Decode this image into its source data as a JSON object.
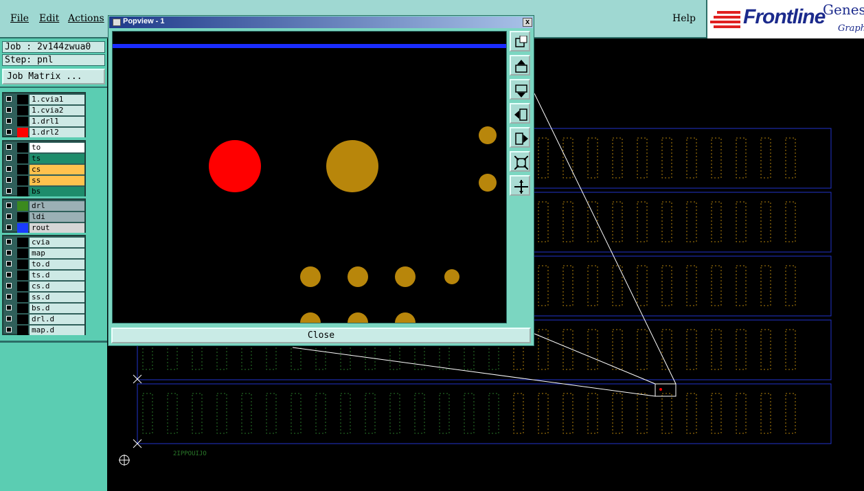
{
  "menu": {
    "file": "File",
    "edit": "Edit",
    "actions": "Actions",
    "help": "Help"
  },
  "logo": {
    "brand": "Frontline",
    "product": "Genes",
    "sub": "Graph"
  },
  "job": {
    "job_line": "Job : 2v144zwua0",
    "step_line": "Step: pnl",
    "matrix_button": "Job Matrix ..."
  },
  "layers": {
    "group1": [
      {
        "name": "1.cvia1",
        "swatch": "#000000",
        "bg": "#cde9e5"
      },
      {
        "name": "1.cvia2",
        "swatch": "#000000",
        "bg": "#cde9e5"
      },
      {
        "name": "1.drl1",
        "swatch": "#000000",
        "bg": "#cde9e5"
      },
      {
        "name": "1.drl2",
        "swatch": "#ff0000",
        "bg": "#cde9e5"
      }
    ],
    "group2": [
      {
        "name": "to",
        "swatch": "#000000",
        "bg": "#ffffff"
      },
      {
        "name": "ts",
        "swatch": "#000000",
        "bg": "#1e8c6b"
      },
      {
        "name": "cs",
        "swatch": "#000000",
        "bg": "#ffc24e"
      },
      {
        "name": "ss",
        "swatch": "#000000",
        "bg": "#ffc24e"
      },
      {
        "name": "bs",
        "swatch": "#000000",
        "bg": "#1e8c6b"
      }
    ],
    "group3": [
      {
        "name": "drl",
        "swatch": "#3b8a1e",
        "bg": "#9bb0b5"
      },
      {
        "name": "ldi",
        "swatch": "#000000",
        "bg": "#9bb0b5"
      },
      {
        "name": "rout",
        "swatch": "#1a3cff",
        "bg": "#d6d6d6"
      }
    ],
    "group4": [
      {
        "name": "cvia",
        "swatch": "#000000",
        "bg": "#cde9e5"
      },
      {
        "name": "map",
        "swatch": "#000000",
        "bg": "#cde9e5"
      },
      {
        "name": "to.d",
        "swatch": "#000000",
        "bg": "#cde9e5"
      },
      {
        "name": "ts.d",
        "swatch": "#000000",
        "bg": "#cde9e5"
      },
      {
        "name": "cs.d",
        "swatch": "#000000",
        "bg": "#cde9e5"
      },
      {
        "name": "ss.d",
        "swatch": "#000000",
        "bg": "#cde9e5"
      },
      {
        "name": "bs.d",
        "swatch": "#000000",
        "bg": "#cde9e5"
      },
      {
        "name": "drl.d",
        "swatch": "#000000",
        "bg": "#cde9e5"
      },
      {
        "name": "map.d",
        "swatch": "#000000",
        "bg": "#cde9e5"
      }
    ]
  },
  "popup": {
    "title": "Popview - 1",
    "close_button": "Close",
    "close_x": "x"
  },
  "popview_tools": [
    "zoom-window-icon",
    "pan-up-icon",
    "pan-down-icon",
    "pan-left-icon",
    "pan-right-icon",
    "zoom-fit-icon",
    "zoom-home-icon"
  ],
  "board": {
    "label": "2IPPOUIJO"
  },
  "colors": {
    "pad": "#b8860b",
    "selected_pad": "#ff0000",
    "border": "#2233cc",
    "green_pad": "#2a7a2a"
  }
}
